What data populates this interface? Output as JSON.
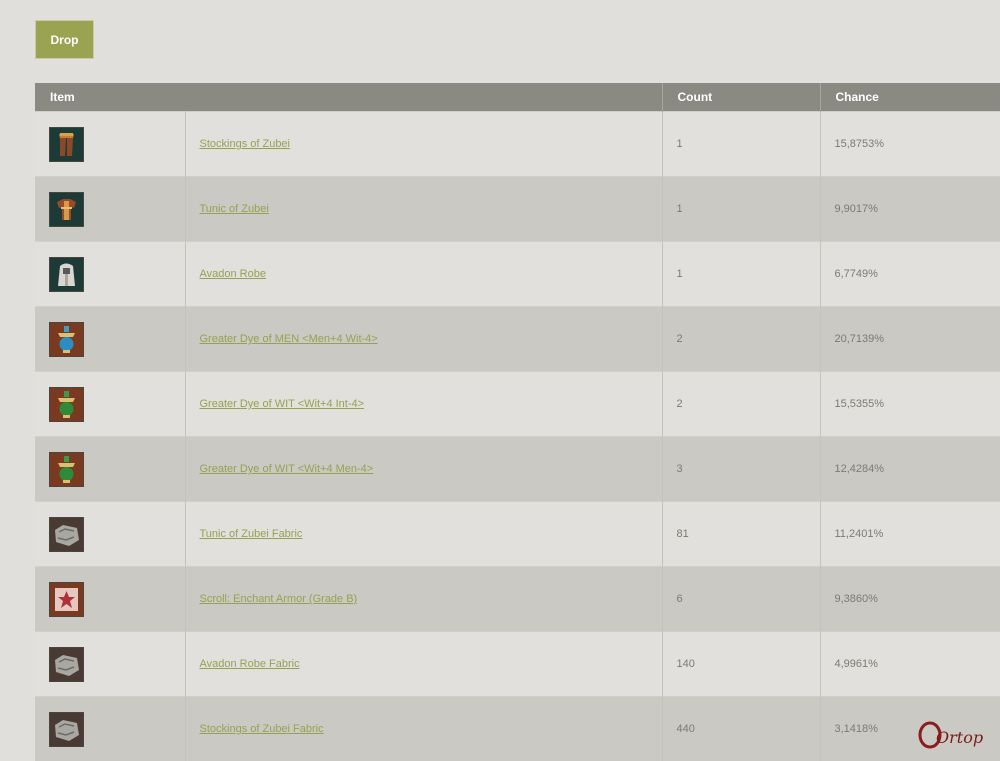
{
  "tabs": {
    "drop_label": "Drop"
  },
  "table": {
    "headers": {
      "item": "Item",
      "count": "Count",
      "chance": "Chance"
    },
    "rows": [
      {
        "icon": "pants-icon",
        "name": "Stockings of Zubei",
        "count": "1",
        "chance": "15,8753%"
      },
      {
        "icon": "tunic-icon",
        "name": "Tunic of Zubei",
        "count": "1",
        "chance": "9,9017%"
      },
      {
        "icon": "robe-icon",
        "name": "Avadon Robe",
        "count": "1",
        "chance": "6,7749%"
      },
      {
        "icon": "dye-blue-icon",
        "name": "Greater Dye of MEN <Men+4 Wit-4>",
        "count": "2",
        "chance": "20,7139%"
      },
      {
        "icon": "dye-green-icon",
        "name": "Greater Dye of WIT <Wit+4 Int-4>",
        "count": "2",
        "chance": "15,5355%"
      },
      {
        "icon": "dye-green-icon",
        "name": "Greater Dye of WIT <Wit+4 Men-4>",
        "count": "3",
        "chance": "12,4284%"
      },
      {
        "icon": "fabric-icon",
        "name": "Tunic of Zubei Fabric",
        "count": "81",
        "chance": "11,2401%"
      },
      {
        "icon": "scroll-icon",
        "name": "Scroll: Enchant Armor (Grade B)",
        "count": "6",
        "chance": "9,3860%"
      },
      {
        "icon": "fabric-icon",
        "name": "Avadon Robe Fabric",
        "count": "140",
        "chance": "4,9961%"
      },
      {
        "icon": "fabric-icon",
        "name": "Stockings of Zubei Fabric",
        "count": "440",
        "chance": "3,1418%"
      }
    ]
  },
  "watermark": {
    "text": "Ortop"
  }
}
